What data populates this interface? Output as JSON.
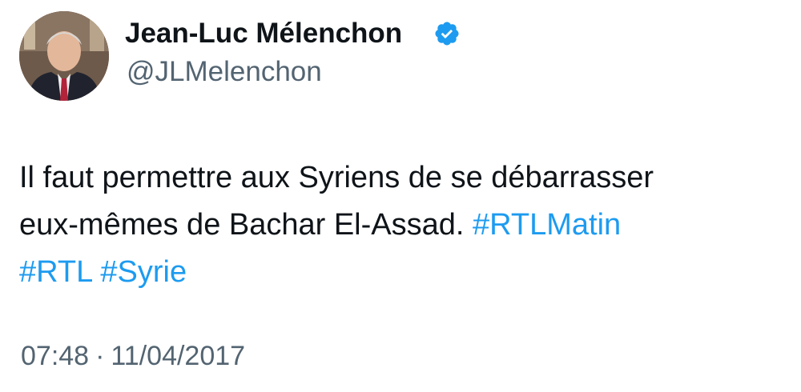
{
  "author": {
    "display_name": "Jean-Luc Mélenchon",
    "handle": "@JLMelenchon",
    "verified": true,
    "avatar_icon": "profile-photo"
  },
  "tweet": {
    "line1": "Il faut permettre aux Syriens de se débarrasser",
    "line2_text": "eux-mêmes de Bachar El-Assad.",
    "hashtags": [
      "#RTLMatin",
      "#RTL",
      "#Syrie"
    ]
  },
  "meta": {
    "time": "07:48",
    "separator": "·",
    "date": "11/04/2017"
  },
  "colors": {
    "link": "#1d9bf0",
    "verified_badge": "#1d9bf0",
    "secondary_text": "#536471",
    "primary_text": "#0f1419"
  }
}
